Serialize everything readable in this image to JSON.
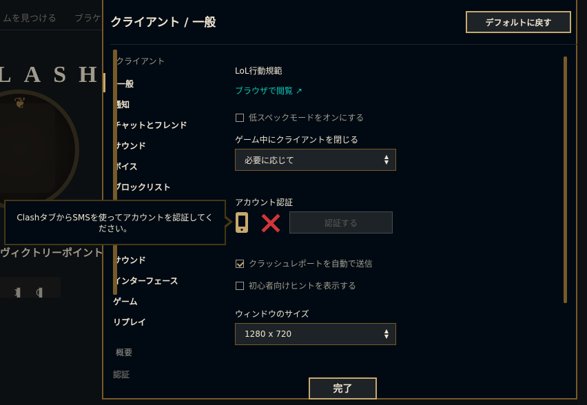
{
  "background": {
    "nav_items": [
      "ムを見つける",
      "ブラケ"
    ],
    "clash_word": "LASH",
    "victory_points": "ヴィクトリーポイント",
    "chip_a": "1",
    "chip_b": "0"
  },
  "modal": {
    "title": "クライアント / 一般",
    "reset_label": "デフォルトに戻す",
    "done_label": "完了"
  },
  "nav": {
    "section_client": "クライアント",
    "items": [
      {
        "label": "一般",
        "active": true
      },
      {
        "label": "通知"
      },
      {
        "label": "チャットとフレンド"
      },
      {
        "label": "サウンド"
      },
      {
        "label": "ボイス"
      },
      {
        "label": "ブロックリスト"
      },
      {
        "label": "サウンド"
      },
      {
        "label": "インターフェース"
      },
      {
        "label": "ゲーム"
      },
      {
        "label": "リプレイ"
      }
    ],
    "section_about": "概要",
    "section_verify": "認証"
  },
  "content": {
    "conduct_title": "LoL行動規範",
    "browser_link": "ブラウザで閲覧 ↗",
    "low_spec_label": "低スペックモードをオンにする",
    "low_spec_checked": false,
    "close_client_label": "ゲーム中にクライアントを閉じる",
    "close_client_value": "必要に応じて",
    "account_verify_label": "アカウント認証",
    "verify_button": "認証する",
    "crash_report_label": "クラッシュレポートを自動で送信",
    "crash_report_checked": true,
    "beginner_hints_label": "初心者向けヒントを表示する",
    "beginner_hints_checked": false,
    "window_size_label": "ウィンドウのサイズ",
    "window_size_value": "1280 x 720"
  },
  "tooltip": {
    "text": "ClashタブからSMSを使ってアカウントを認証してください。"
  },
  "colors": {
    "gold": "#c8aa6e",
    "gold_dark": "#785a28",
    "teal_link": "#0ac8b9",
    "error_red": "#d13639",
    "text_light": "#f0e6d2",
    "text_muted": "#a09b8c"
  },
  "icons": {
    "phone": "phone-icon",
    "not_verified": "x-mark-icon",
    "external": "external-link-icon",
    "select_chevron": "chevron-updown-icon"
  }
}
